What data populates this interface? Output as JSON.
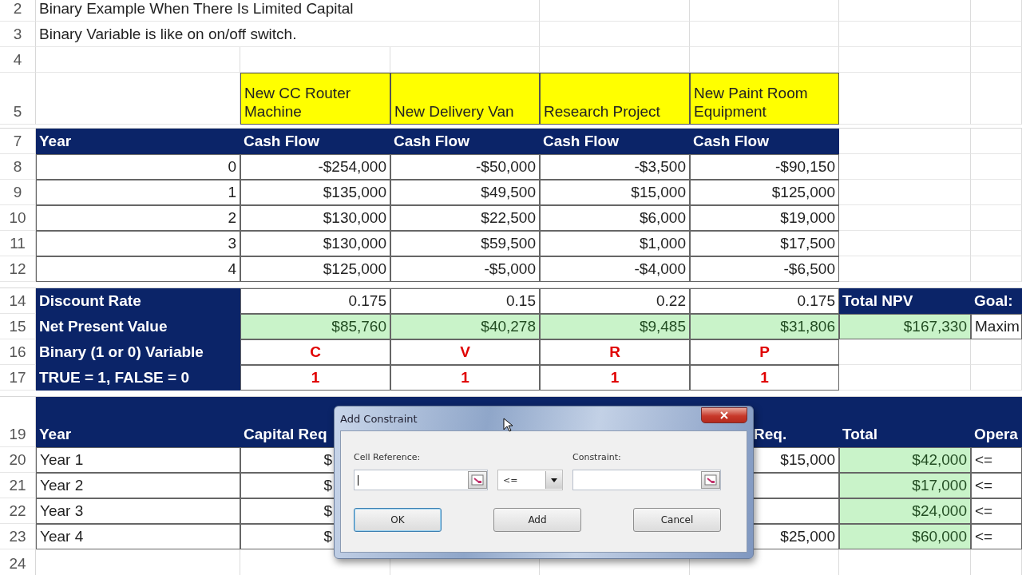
{
  "sheet": {
    "notes": [
      {
        "number": "2",
        "text": "Binary Example When There Is Limited Capital"
      },
      {
        "number": "3",
        "text": "Binary Variable is like on on/off switch."
      }
    ],
    "blank_row": {
      "number": "4"
    },
    "project_names": {
      "number": "5",
      "names": [
        "New CC Router Machine",
        "New Delivery Van",
        "Research Project",
        "New Paint Room Equipment"
      ]
    },
    "cash_flow": {
      "number": "7",
      "columns": [
        "Year",
        "Cash Flow",
        "Cash Flow",
        "Cash Flow",
        "Cash Flow"
      ],
      "rows": [
        {
          "number": "8",
          "year": "0",
          "values": [
            "-$254,000",
            "-$50,000",
            "-$3,500",
            "-$90,150"
          ]
        },
        {
          "number": "9",
          "year": "1",
          "values": [
            "$135,000",
            "$49,500",
            "$15,000",
            "$125,000"
          ]
        },
        {
          "number": "10",
          "year": "2",
          "values": [
            "$130,000",
            "$22,500",
            "$6,000",
            "$19,000"
          ]
        },
        {
          "number": "11",
          "year": "3",
          "values": [
            "$130,000",
            "$59,500",
            "$1,000",
            "$17,500"
          ]
        },
        {
          "number": "12",
          "year": "4",
          "values": [
            "$125,000",
            "-$5,000",
            "-$4,000",
            "-$6,500"
          ]
        }
      ]
    },
    "summary": [
      {
        "number": "14",
        "label": "Discount Rate",
        "kind": "rate",
        "values": [
          "0.175",
          "0.15",
          "0.22",
          "0.175"
        ],
        "extras": [
          {
            "text": "Total NPV",
            "kind": "header"
          },
          {
            "text": "Goal:",
            "kind": "header"
          }
        ]
      },
      {
        "number": "15",
        "label": "Net Present Value",
        "kind": "result",
        "values": [
          "$85,760",
          "$40,278",
          "$9,485",
          "$31,806"
        ],
        "extras": [
          {
            "text": "$167,330",
            "kind": "result"
          },
          {
            "text": "Maxim",
            "kind": "plain"
          }
        ]
      },
      {
        "number": "16",
        "label": "Binary (1 or 0) Variable",
        "kind": "flag",
        "values": [
          "C",
          "V",
          "R",
          "P"
        ]
      },
      {
        "number": "17",
        "label": "TRUE = 1, FALSE = 0",
        "kind": "flag",
        "values": [
          "1",
          "1",
          "1",
          "1"
        ]
      }
    ],
    "capital": {
      "number": "19",
      "header": {
        "year": "Year",
        "capital": "Capital Req",
        "column_5": "Req.",
        "total": "Total",
        "operator": "Opera"
      },
      "rows": [
        {
          "number": "20",
          "year": "Year 1",
          "capital": "$",
          "column_5": "$15,000",
          "total": "$42,000",
          "operator": "<="
        },
        {
          "number": "21",
          "year": "Year 2",
          "capital": "$",
          "total": "$17,000",
          "operator": "<="
        },
        {
          "number": "22",
          "year": "Year 3",
          "capital": "$",
          "total": "$24,000",
          "operator": "<="
        },
        {
          "number": "23",
          "year": "Year 4",
          "capital": "$",
          "column_5": "$25,000",
          "total": "$60,000",
          "operator": "<="
        }
      ]
    },
    "last_row": {
      "number": "24"
    }
  },
  "dialog": {
    "title": "Add Constraint",
    "cell_reference_label": "Cell Reference:",
    "operator": "<=",
    "constraint_label": "Constraint:",
    "buttons": [
      {
        "label": "OK",
        "selected": true
      },
      {
        "label": "Add",
        "selected": false
      },
      {
        "label": "Cancel",
        "selected": false
      }
    ]
  }
}
